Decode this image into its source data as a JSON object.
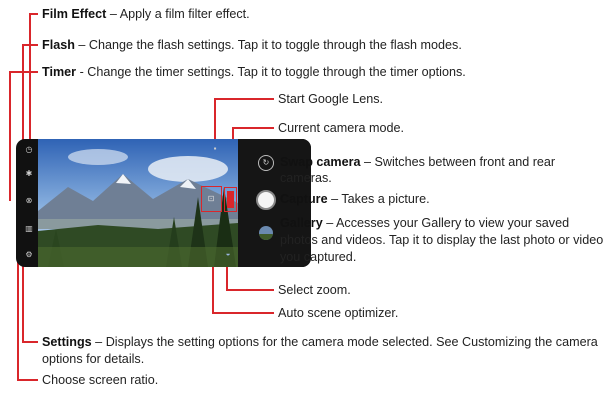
{
  "callouts": {
    "film_effect": {
      "term": "Film Effect",
      "desc": " – Apply a film filter effect."
    },
    "flash": {
      "term": "Flash",
      "desc": " – Change the flash settings. Tap it to toggle through the flash modes."
    },
    "timer": {
      "term": "Timer",
      "desc": " - Change the timer settings. Tap it to toggle through the timer options."
    },
    "google_lens": {
      "text": "Start Google Lens."
    },
    "camera_mode": {
      "text": "Current camera mode."
    },
    "swap_camera": {
      "term": "Swap camera",
      "desc": " – Switches between front and rear cameras."
    },
    "capture": {
      "term": "Capture",
      "desc": " – Takes a picture."
    },
    "gallery": {
      "term": "Gallery",
      "desc": " – Accesses your Gallery to view your saved photos and videos. Tap it to display the last photo or video you captured."
    },
    "select_zoom": {
      "text": "Select zoom."
    },
    "scene_optimizer": {
      "text": "Auto scene optimizer."
    },
    "settings": {
      "term": "Settings",
      "desc": " – Displays the setting options for the camera mode selected. See Customizing the camera options for details."
    },
    "screen_ratio": {
      "text": "Choose screen ratio."
    }
  },
  "icons": {
    "film": "film-icon",
    "flash": "flash-icon",
    "timer": "timer-icon",
    "ratio": "ratio-icon",
    "settings": "gear-icon",
    "lens": "lens-icon",
    "swap": "swap-camera-icon",
    "zoom": "zoom-icon",
    "scene": "scene-optimizer-icon",
    "gallery": "gallery-thumbnail"
  },
  "colors": {
    "callout_line": "#d9262b",
    "phone_body": "#111111"
  }
}
